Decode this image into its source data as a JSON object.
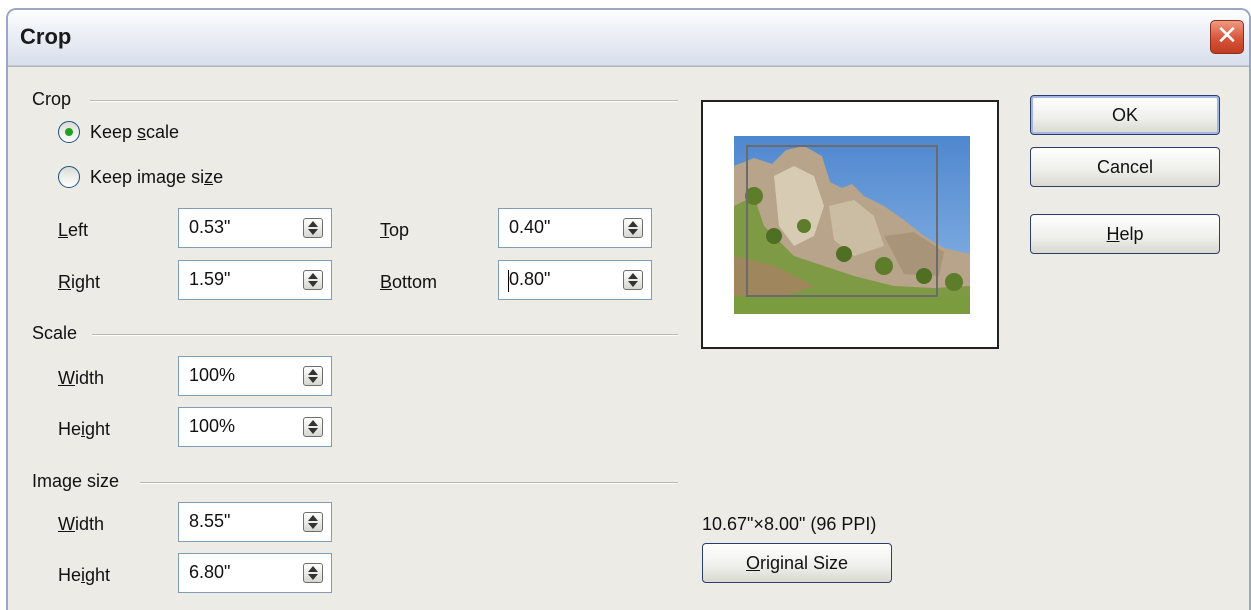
{
  "window": {
    "title": "Crop",
    "close_glyph": "✕"
  },
  "crop": {
    "section_label": "Crop",
    "keep_scale": {
      "pre": "Keep ",
      "key": "s",
      "post": "cale",
      "checked": true
    },
    "keep_image_size": {
      "pre": "Keep image si",
      "key": "z",
      "post": "e",
      "checked": false
    },
    "left": {
      "key": "L",
      "rest": "eft",
      "value": "0.53\""
    },
    "right": {
      "key": "R",
      "rest": "ight",
      "value": "1.59\""
    },
    "top": {
      "key": "T",
      "rest": "op",
      "value": "0.40\""
    },
    "bottom": {
      "key": "B",
      "rest": "ottom",
      "value": "0.80\""
    }
  },
  "scale": {
    "section_label": "Scale",
    "width": {
      "key": "W",
      "rest": "idth",
      "value": "100%"
    },
    "height": {
      "pre": "He",
      "key": "i",
      "post": "ght",
      "value": "100%"
    }
  },
  "image_size": {
    "section_label": "Image size",
    "width": {
      "key": "W",
      "rest": "idth",
      "value": "8.55\""
    },
    "height": {
      "pre": "He",
      "key": "i",
      "post": "ght",
      "value": "6.80\""
    }
  },
  "original": {
    "info": "10.67\"×8.00\" (96 PPI)",
    "button": {
      "key": "O",
      "rest": "riginal Size"
    }
  },
  "buttons": {
    "ok": "OK",
    "cancel": "Cancel",
    "help": {
      "key": "H",
      "rest": "elp"
    }
  },
  "colors": {
    "accent": "#21a121",
    "title_gradient_end": "#d9dfeb",
    "close": "#d8543a"
  }
}
